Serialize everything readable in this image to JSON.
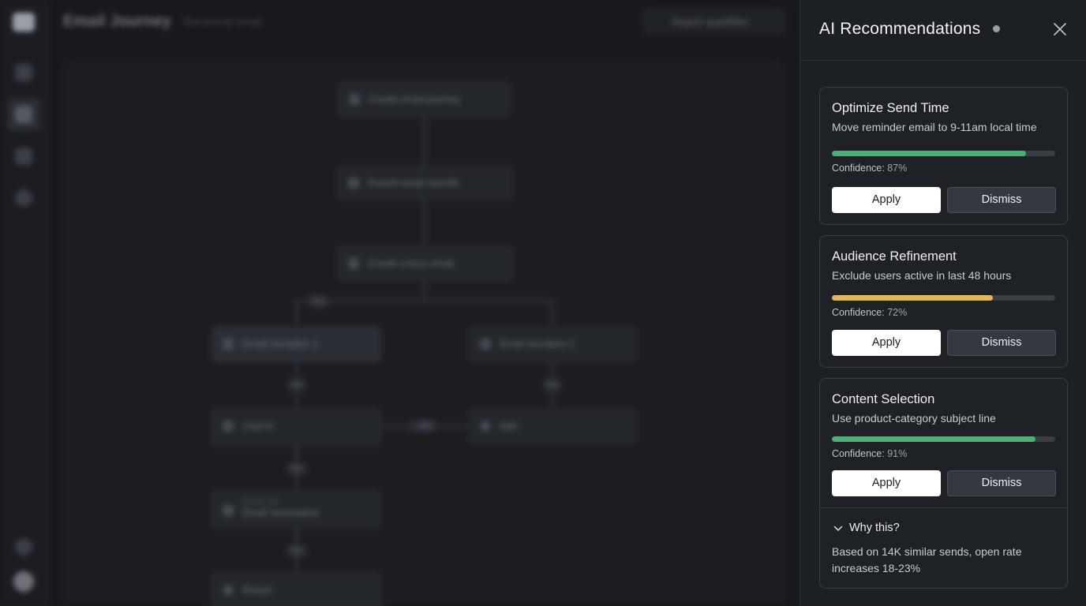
{
  "app": {
    "title": "Email Journey",
    "breadcrumb": "Recommer email",
    "report_button": "Report quarkflon"
  },
  "flow": {
    "nodes": [
      {
        "label": "Create email journey"
      },
      {
        "label": "Exeorit email nerrofe"
      },
      {
        "label": "Create crocur email"
      },
      {
        "label": "Email Iovnation 1"
      },
      {
        "label": "Email Iovvation 2"
      },
      {
        "label": "Lioyrch"
      },
      {
        "label": "Add"
      },
      {
        "label": "Email renrimation",
        "sub": "Sterme nell"
      },
      {
        "label": "Resurt"
      }
    ],
    "pills": [
      "Yes",
      "No",
      "No",
      "No",
      "No",
      "...Bild"
    ]
  },
  "panel": {
    "title": "AI Recommendations",
    "cards": [
      {
        "title": "Optimize Send Time",
        "description": "Move reminder email to 9-11am local time",
        "confidence_label": "Confidence:",
        "confidence_text": "87%",
        "confidence": 0.87,
        "bar_color": "#4caf76",
        "apply": "Apply",
        "dismiss": "Dismiss"
      },
      {
        "title": "Audience Refinement",
        "description": "Exclude users active in last 48 hours",
        "confidence_label": "Confidence:",
        "confidence_text": "72%",
        "confidence": 0.72,
        "bar_color": "#e0b461",
        "apply": "Apply",
        "dismiss": "Dismiss"
      },
      {
        "title": "Content Selection",
        "description": "Use product-category subject line",
        "confidence_label": "Confidence:",
        "confidence_text": "91%",
        "confidence": 0.91,
        "bar_color": "#4caf76",
        "apply": "Apply",
        "dismiss": "Dismiss",
        "why_label": "Why this?",
        "why_text": "Based on 14K similar sends, open rate increases 18-23%"
      }
    ]
  }
}
